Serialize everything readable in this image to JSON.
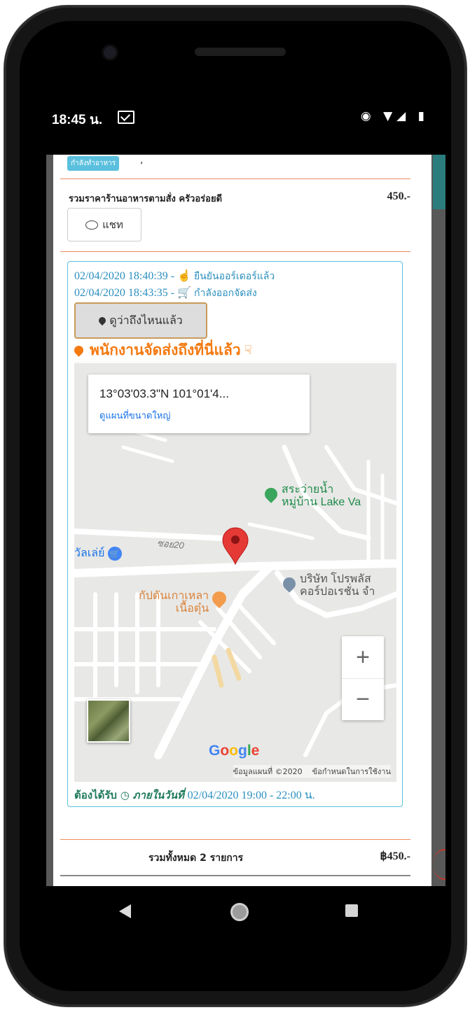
{
  "status_bar": {
    "time": "18:45 น.",
    "icons": "◉ ▼◢ ▮"
  },
  "order": {
    "badge": "กำลังทำอาหาร",
    "badge_suffix": ",",
    "subtotal_label": "รวมราคาร้านอาหารตามสั่ง ครัวอร่อยดี",
    "subtotal_price": "450.-",
    "chat_label": "แชท"
  },
  "tracking": {
    "log1_time": "02/04/2020 18:40:39 -",
    "log1_icon": "thumbs-up-icon",
    "log1_text": "ยืนยันออร์เดอร์แล้ว",
    "log2_time": "02/04/2020 18:43:35 -",
    "log2_icon": "cart-icon",
    "log2_text": "กำลังออกจัดส่ง",
    "where_button": "ดูว่าถึงไหนแล้ว",
    "arrived_text": "พนักงานจัดส่งถึงที่นี่แล้ว",
    "arrived_suffix_icon": "thumbs-down-icon"
  },
  "map": {
    "coord": "13°03'03.3\"N 101°01'4...",
    "link": "ดูแผนที่ขนาดใหญ่",
    "poi_lake_line1": "สระว่ายน้ำ",
    "poi_lake_line2": "หมู่บ้าน Lake Va",
    "road_label": "ซอย20",
    "poi_left": "วัลเล่ย์",
    "poi_company_line1": "บริษัท โปรพลัส",
    "poi_company_line2": "คอร์ปอเรชั่น จำ",
    "poi_restaurant_line1": "กัปตันเกาเหลา",
    "poi_restaurant_line2": "เนื้อตุ๋น",
    "zoom_in": "+",
    "zoom_out": "−",
    "google": "Google",
    "footer_data": "ข้อมูลแผนที่ ©2020",
    "footer_terms": "ข้อกำหนดในการใช้งาน"
  },
  "delivery": {
    "label": "ต้องได้รับ",
    "label2": "ภายในวันที่",
    "value": "02/04/2020 19:00 - 22:00 น."
  },
  "total": {
    "label": "รวมทั้งหมด 2 รายการ",
    "price": "฿450.-"
  },
  "colors": {
    "teal": "#2b7d7d",
    "info": "#2a8fbd",
    "orange": "#f47a10",
    "green_text": "#1e7a5a",
    "pin_red": "#e53935"
  }
}
